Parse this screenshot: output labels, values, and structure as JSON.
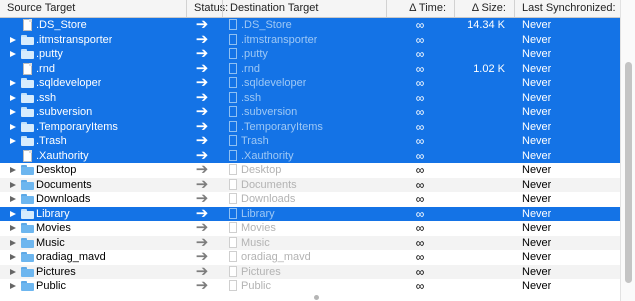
{
  "columns": {
    "source": "Source Target",
    "status": "Status:",
    "destination": "Destination Target",
    "time": "Δ Time:",
    "size": "Δ Size:",
    "sync": "Last Synchronized:"
  },
  "colors": {
    "selection": "#1473e6",
    "folder": "#6db6ef",
    "arrow": "#7d7d7d"
  },
  "rows": [
    {
      "name": ".DS_Store",
      "kind": "file",
      "dest": ".DS_Store",
      "time": "∞",
      "size": "14.34 K",
      "sync": "Never",
      "selected": true
    },
    {
      "name": ".itmstransporter",
      "kind": "folder",
      "dest": ".itmstransporter",
      "time": "∞",
      "size": "",
      "sync": "Never",
      "selected": true
    },
    {
      "name": ".putty",
      "kind": "folder",
      "dest": ".putty",
      "time": "∞",
      "size": "",
      "sync": "Never",
      "selected": true
    },
    {
      "name": ".rnd",
      "kind": "file",
      "dest": ".rnd",
      "time": "∞",
      "size": "1.02 K",
      "sync": "Never",
      "selected": true
    },
    {
      "name": ".sqldeveloper",
      "kind": "folder",
      "dest": ".sqldeveloper",
      "time": "∞",
      "size": "",
      "sync": "Never",
      "selected": true
    },
    {
      "name": ".ssh",
      "kind": "folder",
      "dest": ".ssh",
      "time": "∞",
      "size": "",
      "sync": "Never",
      "selected": true
    },
    {
      "name": ".subversion",
      "kind": "folder",
      "dest": ".subversion",
      "time": "∞",
      "size": "",
      "sync": "Never",
      "selected": true
    },
    {
      "name": ".TemporaryItems",
      "kind": "folder",
      "dest": ".TemporaryItems",
      "time": "∞",
      "size": "",
      "sync": "Never",
      "selected": true
    },
    {
      "name": ".Trash",
      "kind": "folder",
      "dest": "Trash",
      "time": "∞",
      "size": "",
      "sync": "Never",
      "selected": true
    },
    {
      "name": ".Xauthority",
      "kind": "file",
      "dest": ".Xauthority",
      "time": "∞",
      "size": "",
      "sync": "Never",
      "selected": true
    },
    {
      "name": "Desktop",
      "kind": "folder",
      "dest": "Desktop",
      "time": "∞",
      "size": "",
      "sync": "Never",
      "selected": false
    },
    {
      "name": "Documents",
      "kind": "folder",
      "dest": "Documents",
      "time": "∞",
      "size": "",
      "sync": "Never",
      "selected": false
    },
    {
      "name": "Downloads",
      "kind": "folder",
      "dest": "Downloads",
      "time": "∞",
      "size": "",
      "sync": "Never",
      "selected": false
    },
    {
      "name": "Library",
      "kind": "folder",
      "dest": "Library",
      "time": "∞",
      "size": "",
      "sync": "Never",
      "selected": true
    },
    {
      "name": "Movies",
      "kind": "folder",
      "dest": "Movies",
      "time": "∞",
      "size": "",
      "sync": "Never",
      "selected": false
    },
    {
      "name": "Music",
      "kind": "folder",
      "dest": "Music",
      "time": "∞",
      "size": "",
      "sync": "Never",
      "selected": false
    },
    {
      "name": "oradiag_mavd",
      "kind": "folder",
      "dest": "oradiag_mavd",
      "time": "∞",
      "size": "",
      "sync": "Never",
      "selected": false
    },
    {
      "name": "Pictures",
      "kind": "folder",
      "dest": "Pictures",
      "time": "∞",
      "size": "",
      "sync": "Never",
      "selected": false
    },
    {
      "name": "Public",
      "kind": "folder",
      "dest": "Public",
      "time": "∞",
      "size": "",
      "sync": "Never",
      "selected": false
    }
  ]
}
